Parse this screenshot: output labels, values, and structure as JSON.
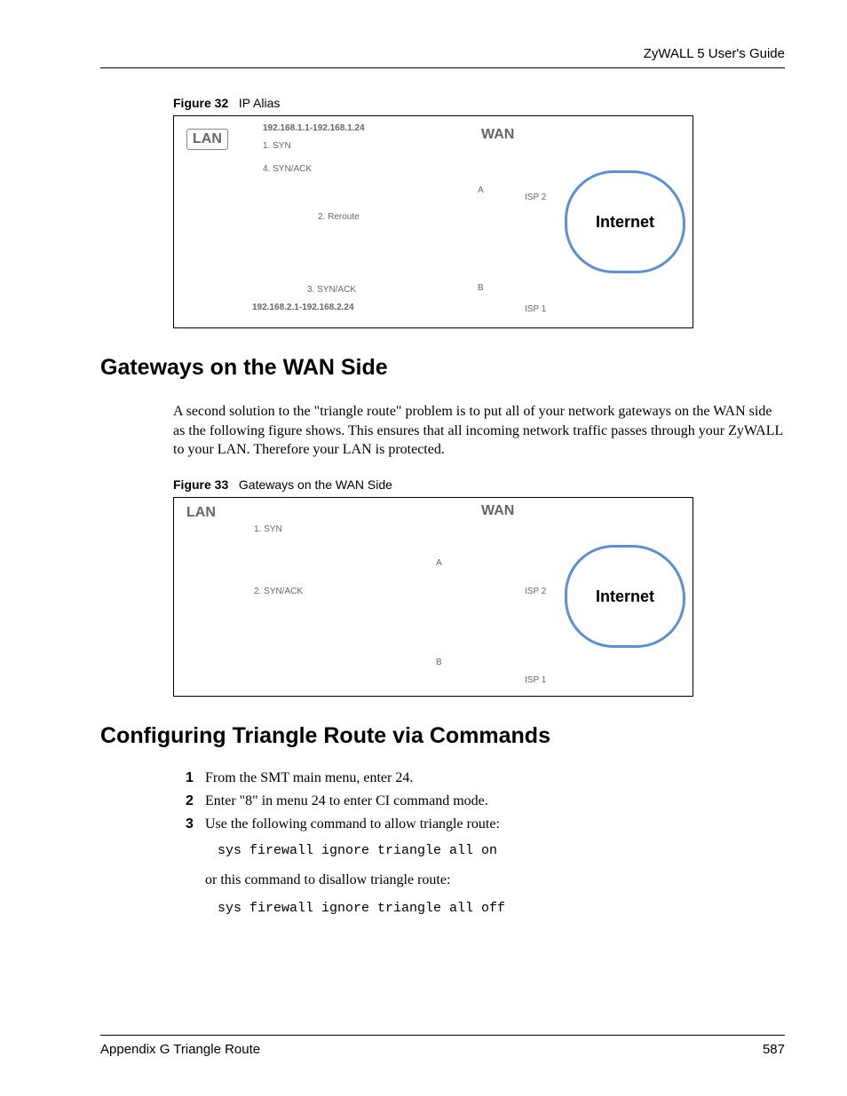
{
  "header": {
    "guide_title": "ZyWALL 5 User's Guide"
  },
  "figure32": {
    "caption_label": "Figure 32",
    "caption_text": "IP Alias",
    "labels": {
      "lan": "LAN",
      "wan": "WAN",
      "internet": "Internet",
      "ip_range_a": "192.168.1.1-192.168.1.24",
      "ip_range_b": "192.168.2.1-192.168.2.24",
      "step1": "1. SYN",
      "step2": "2. Reroute",
      "step3": "3. SYN/ACK",
      "step4": "4. SYN/ACK",
      "node_a": "A",
      "node_b": "B",
      "isp1": "ISP 1",
      "isp2": "ISP 2"
    }
  },
  "section_gateways": {
    "heading": "Gateways on the WAN Side",
    "paragraph": "A second solution to the \"triangle route\" problem is to put all of your network gateways on the WAN side as the following figure shows. This ensures that all incoming network traffic passes through your ZyWALL to your LAN. Therefore your LAN is protected."
  },
  "figure33": {
    "caption_label": "Figure 33",
    "caption_text": "Gateways on the WAN Side",
    "labels": {
      "lan": "LAN",
      "wan": "WAN",
      "internet": "Internet",
      "step1": "1. SYN",
      "step2": "2. SYN/ACK",
      "node_a": "A",
      "node_b": "B",
      "isp1": "ISP 1",
      "isp2": "ISP 2"
    }
  },
  "section_config": {
    "heading": "Configuring Triangle Route via Commands",
    "steps": {
      "s1": "From the SMT main menu, enter 24.",
      "s2": "Enter \"8\" in menu 24 to enter CI command mode.",
      "s3": "Use the following command to allow triangle route:"
    },
    "nums": {
      "n1": "1",
      "n2": "2",
      "n3": "3"
    },
    "code_on": "sys firewall ignore triangle all on",
    "or_text": "or this command to disallow triangle route:",
    "code_off": "sys firewall ignore triangle all off"
  },
  "footer": {
    "appendix": "Appendix G Triangle Route",
    "page_number": "587"
  }
}
